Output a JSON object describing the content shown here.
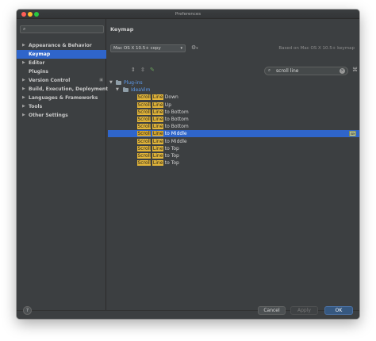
{
  "window": {
    "title": "Preferences"
  },
  "sidebar": {
    "search_placeholder": "",
    "items": [
      {
        "label": "Appearance & Behavior",
        "expandable": true,
        "selected": false
      },
      {
        "label": "Keymap",
        "expandable": false,
        "selected": true
      },
      {
        "label": "Editor",
        "expandable": true,
        "selected": false
      },
      {
        "label": "Plugins",
        "expandable": false,
        "selected": false
      },
      {
        "label": "Version Control",
        "expandable": true,
        "selected": false
      },
      {
        "label": "Build, Execution, Deployment",
        "expandable": true,
        "selected": false
      },
      {
        "label": "Languages & Frameworks",
        "expandable": true,
        "selected": false
      },
      {
        "label": "Tools",
        "expandable": true,
        "selected": false
      },
      {
        "label": "Other Settings",
        "expandable": true,
        "selected": false
      }
    ]
  },
  "main": {
    "title": "Keymap",
    "preset_value": "Mac OS X 10.5+ copy",
    "based_on": "Based on Mac OS X 10.5+ keymap",
    "search_value": "scroll line",
    "tree": {
      "root": "Plug-ins",
      "child": "IdeaVim",
      "actions": [
        {
          "match1": "Scroll",
          "match2": "Line",
          "rest": " Down",
          "selected": false
        },
        {
          "match1": "Scroll",
          "match2": "Line",
          "rest": " Up",
          "selected": false
        },
        {
          "match1": "Scroll",
          "match2": "Line",
          "rest": " to Bottom",
          "selected": false
        },
        {
          "match1": "Scroll",
          "match2": "Line",
          "rest": " to Bottom",
          "selected": false
        },
        {
          "match1": "Scroll",
          "match2": "Line",
          "rest": " to Bottom",
          "selected": false
        },
        {
          "match1": "Scroll",
          "match2": "Line",
          "rest": " to Middle",
          "selected": true
        },
        {
          "match1": "Scroll",
          "match2": "Line",
          "rest": " to Middle",
          "selected": false
        },
        {
          "match1": "Scroll",
          "match2": "Line",
          "rest": " to Top",
          "selected": false
        },
        {
          "match1": "Scroll",
          "match2": "Line",
          "rest": " to Top",
          "selected": false
        },
        {
          "match1": "Scroll",
          "match2": "Line",
          "rest": " to Top",
          "selected": false
        }
      ]
    }
  },
  "footer": {
    "help": "?",
    "cancel": "Cancel",
    "apply": "Apply",
    "ok": "OK"
  },
  "colors": {
    "background": "#3c3f41",
    "selection": "#2f65ca",
    "highlight": "#e2b53a",
    "ok_button": "#365880",
    "tree_link": "#5e9cef"
  }
}
